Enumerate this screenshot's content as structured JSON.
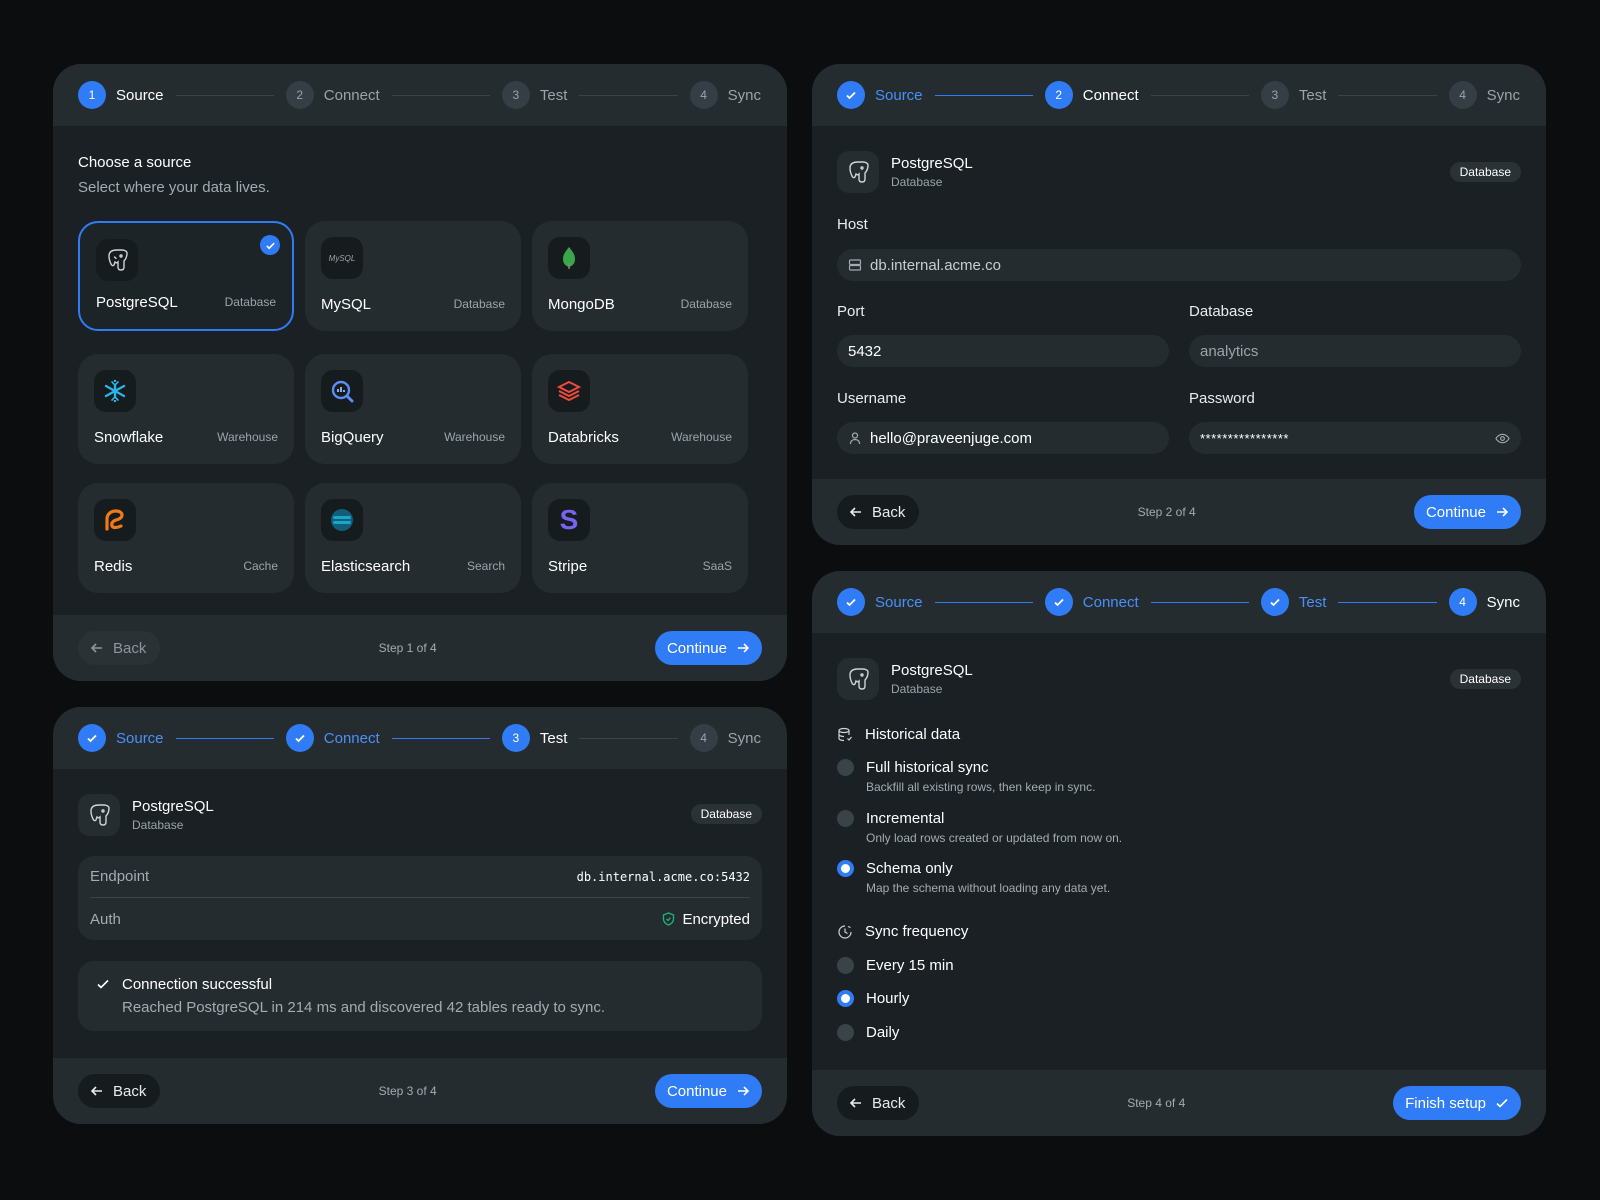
{
  "steps": [
    "Source",
    "Connect",
    "Test",
    "Sync"
  ],
  "step_numbers": [
    "1",
    "2",
    "3",
    "4"
  ],
  "common": {
    "back": "Back",
    "continue": "Continue",
    "finish": "Finish setup",
    "db_name": "PostgreSQL",
    "db_type": "Database",
    "db_badge": "Database"
  },
  "card1": {
    "title": "Choose a source",
    "subtitle": "Select where your data lives.",
    "sources": [
      {
        "name": "PostgreSQL",
        "type": "Database",
        "icon": "postgresql-icon"
      },
      {
        "name": "MySQL",
        "type": "Database",
        "icon": "mysql-icon",
        "logo_text": "MySQL"
      },
      {
        "name": "MongoDB",
        "type": "Database",
        "icon": "mongodb-icon"
      },
      {
        "name": "Snowflake",
        "type": "Warehouse",
        "icon": "snowflake-icon"
      },
      {
        "name": "BigQuery",
        "type": "Warehouse",
        "icon": "bigquery-icon"
      },
      {
        "name": "Databricks",
        "type": "Warehouse",
        "icon": "databricks-icon"
      },
      {
        "name": "Redis",
        "type": "Cache",
        "icon": "redis-icon"
      },
      {
        "name": "Elasticsearch",
        "type": "Search",
        "icon": "elasticsearch-icon"
      },
      {
        "name": "Stripe",
        "type": "SaaS",
        "icon": "stripe-icon",
        "logo_text": "S"
      }
    ],
    "step_count": "Step 1 of 4"
  },
  "card2": {
    "host_label": "Host",
    "host_value": "db.internal.acme.co",
    "port_label": "Port",
    "port_value": "5432",
    "database_label": "Database",
    "database_placeholder": "analytics",
    "username_label": "Username",
    "username_value": "hello@praveenjuge.com",
    "password_label": "Password",
    "password_value": "****************",
    "step_count": "Step 2 of 4"
  },
  "card3": {
    "endpoint_label": "Endpoint",
    "endpoint_value": "db.internal.acme.co:5432",
    "auth_label": "Auth",
    "auth_value": "Encrypted",
    "success_title": "Connection successful",
    "success_desc": "Reached PostgreSQL in 214 ms and discovered 42 tables ready to sync.",
    "step_count": "Step 3 of 4"
  },
  "card4": {
    "historical_title": "Historical data",
    "historical_options": [
      {
        "title": "Full historical sync",
        "desc": "Backfill all existing rows, then keep in sync.",
        "selected": false
      },
      {
        "title": "Incremental",
        "desc": "Only load rows created or updated from now on.",
        "selected": false
      },
      {
        "title": "Schema only",
        "desc": "Map the schema without loading any data yet.",
        "selected": true
      }
    ],
    "frequency_title": "Sync frequency",
    "frequency_options": [
      {
        "title": "Every 15 min",
        "selected": false
      },
      {
        "title": "Hourly",
        "selected": true
      },
      {
        "title": "Daily",
        "selected": false
      }
    ],
    "step_count": "Step 4 of 4"
  },
  "colors": {
    "accent": "#2f7cf6",
    "card": "#1a2024",
    "header": "#242c30",
    "success": "#1fb27a"
  }
}
